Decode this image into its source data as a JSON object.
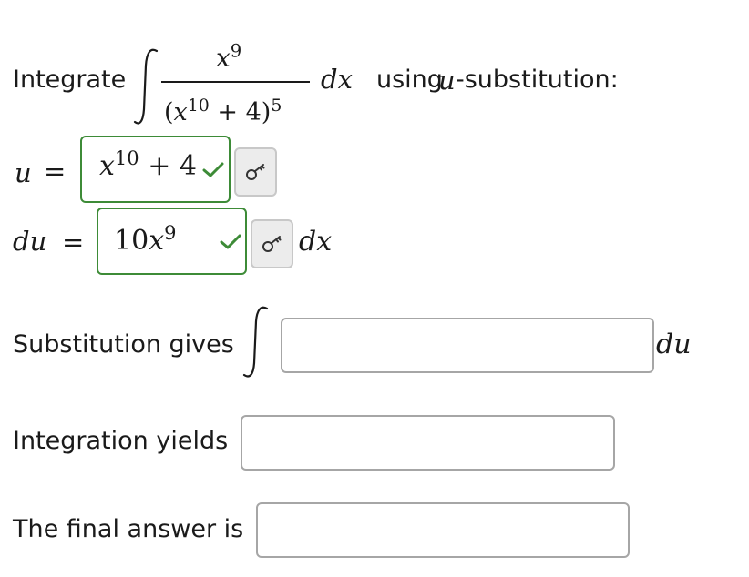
{
  "prompt": {
    "before": "Integrate",
    "numerator_base": "x",
    "numerator_exp": "9",
    "denominator_base_var": "x",
    "denominator_inner_exp": "10",
    "denominator_plus": "+ 4)",
    "denominator_open": "(",
    "denominator_outer_exp": "5",
    "differential": "dx",
    "using": "using",
    "u_var": "u",
    "after": "-substitution:"
  },
  "u_row": {
    "label_var": "u",
    "equals": "=",
    "answer_base": "x",
    "answer_exp": "10",
    "answer_rest": "+ 4",
    "status": "correct"
  },
  "du_row": {
    "label": "du",
    "equals": "=",
    "answer_coef": "10",
    "answer_base": "x",
    "answer_exp": "9",
    "suffix": "dx",
    "status": "correct"
  },
  "substitution": {
    "label": "Substitution gives",
    "integral_sign": "∫",
    "value": "",
    "suffix": "du"
  },
  "integration": {
    "label": "Integration yields",
    "value": ""
  },
  "final": {
    "label": "The final answer is",
    "value": ""
  },
  "icons": {
    "key": "key-icon",
    "check": "check-icon"
  },
  "colors": {
    "correct": "#3d8b37",
    "input_border": "#a6a6a6",
    "key_button_bg": "#ececec"
  }
}
